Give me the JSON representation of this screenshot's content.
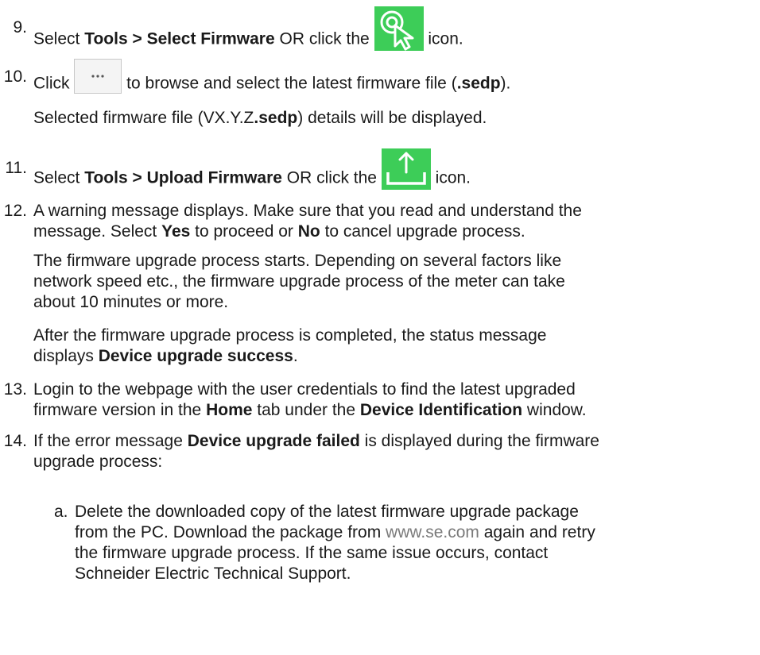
{
  "steps": [
    {
      "num": "9.",
      "pre": "Select ",
      "b1": "Tools > Select Firmware",
      "mid": " OR click the ",
      "post": " icon.",
      "icon": "select-firmware-icon"
    },
    {
      "num": "10.",
      "pre": "Click ",
      "mid": " to browse and select the latest firmware file (",
      "b1": ".sedp",
      "post": ").",
      "icon": "browse-icon",
      "note_pre": "Selected firmware file (VX.Y.Z",
      "note_b": ".sedp",
      "note_post": ") details will be displayed."
    },
    {
      "num": "11.",
      "pre": "Select ",
      "b1": "Tools > Upload Firmware",
      "mid": " OR click the ",
      "post": " icon.",
      "icon": "upload-firmware-icon"
    },
    {
      "num": "12.",
      "line1": "A warning message displays. Make sure that you read and understand the",
      "l2pre": "message. Select ",
      "b1": "Yes",
      "l2mid": " to proceed or ",
      "b2": "No",
      "l2post": " to cancel upgrade process.",
      "p1": [
        "The firmware upgrade process starts. Depending on several factors like",
        "network speed etc., the firmware upgrade process of the meter can take",
        "about 10 minutes or more."
      ],
      "p2l1": "After the firmware upgrade process is completed, the status message",
      "p2pre": "displays ",
      "p2b": "Device upgrade success",
      "p2post": "."
    },
    {
      "num": "13.",
      "line1": "Login to the webpage with the user credentials to find the latest upgraded",
      "l2pre": "firmware version in the ",
      "b1": "Home",
      "l2mid": " tab under the ",
      "b2": "Device Identification",
      "l2post": " window."
    },
    {
      "num": "14.",
      "pre": "If the error message ",
      "b1": "Device upgrade failed",
      "post": " is displayed during the firmware",
      "line2": "upgrade process:",
      "sub": {
        "letter": "a.",
        "lines": [
          "Delete the downloaded copy of the latest firmware upgrade package",
          "from the PC. Download the package from ",
          " again and retry",
          "the firmware upgrade process. If the same issue occurs, contact",
          "Schneider Electric Technical Support."
        ],
        "link": "www.se.com"
      }
    }
  ]
}
